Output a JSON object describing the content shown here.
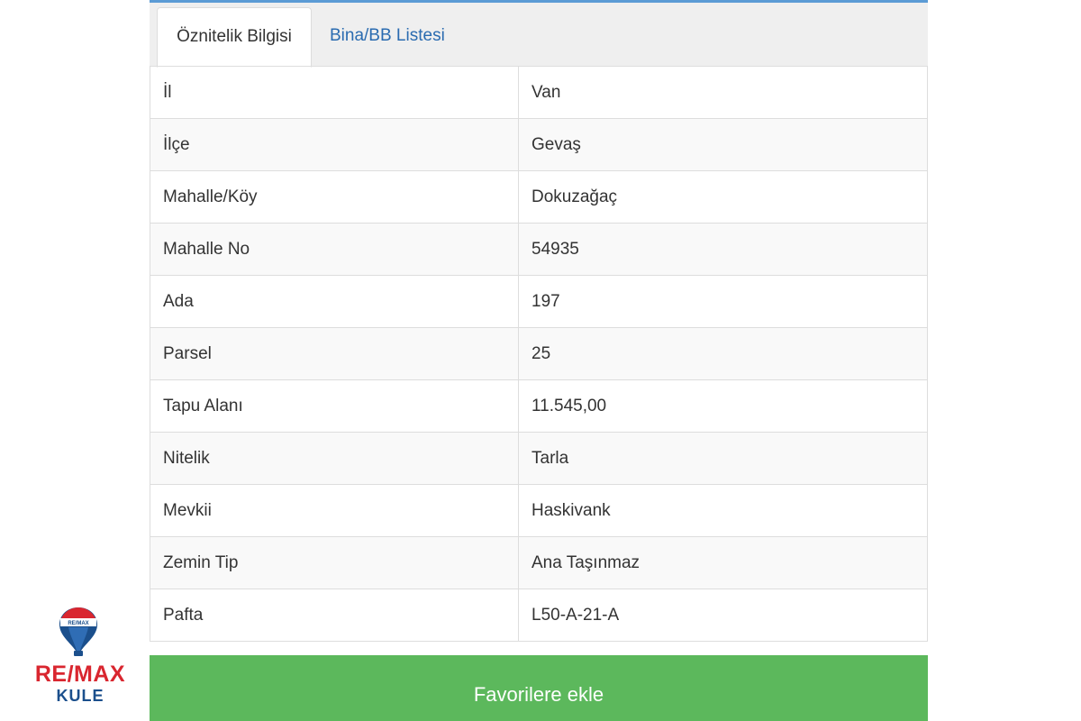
{
  "tabs": [
    {
      "label": "Öznitelik Bilgisi",
      "active": true
    },
    {
      "label": "Bina/BB Listesi",
      "active": false
    }
  ],
  "attributes": [
    {
      "key": "İl",
      "value": "Van"
    },
    {
      "key": "İlçe",
      "value": "Gevaş"
    },
    {
      "key": "Mahalle/Köy",
      "value": "Dokuzağaç"
    },
    {
      "key": "Mahalle No",
      "value": "54935"
    },
    {
      "key": "Ada",
      "value": "197"
    },
    {
      "key": "Parsel",
      "value": "25"
    },
    {
      "key": "Tapu Alanı",
      "value": "11.545,00"
    },
    {
      "key": "Nitelik",
      "value": "Tarla"
    },
    {
      "key": "Mevkii",
      "value": "Haskivank"
    },
    {
      "key": "Zemin Tip",
      "value": "Ana Taşınmaz"
    },
    {
      "key": "Pafta",
      "value": "L50-A-21-A"
    }
  ],
  "favorite_button_label": "Favorilere ekle",
  "watermark": {
    "brand": "RE/MAX",
    "office": "KULE",
    "balloon_text": "RE/MAX"
  },
  "colors": {
    "button_green": "#5cb85c",
    "tab_link": "#2a6bb0",
    "brand_red": "#d9262f",
    "brand_blue": "#1b4f8c"
  }
}
